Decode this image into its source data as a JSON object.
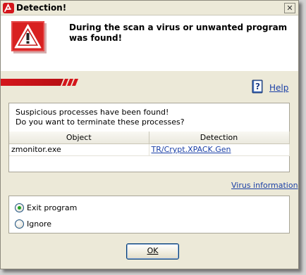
{
  "window": {
    "title": "Detection!",
    "close_label": "✕"
  },
  "banner": {
    "message": "During the scan a virus or unwanted program was found!"
  },
  "help": {
    "label": "Help"
  },
  "panel": {
    "message_lines": [
      "Suspicious processes have been found!",
      "Do you want to terminate these processes?"
    ],
    "columns": [
      "Object",
      "Detection"
    ],
    "rows": [
      {
        "object": "zmonitor.exe",
        "detection": "TR/Crypt.XPACK.Gen"
      }
    ]
  },
  "virus_info_label": "Virus information",
  "options": [
    {
      "label": "Exit program",
      "selected": true
    },
    {
      "label": "Ignore",
      "selected": false
    }
  ],
  "ok_label": "OK",
  "colors": {
    "brand_red": "#d4161c",
    "link_blue": "#1a3fa6",
    "dialog_bg": "#ece9d8"
  }
}
